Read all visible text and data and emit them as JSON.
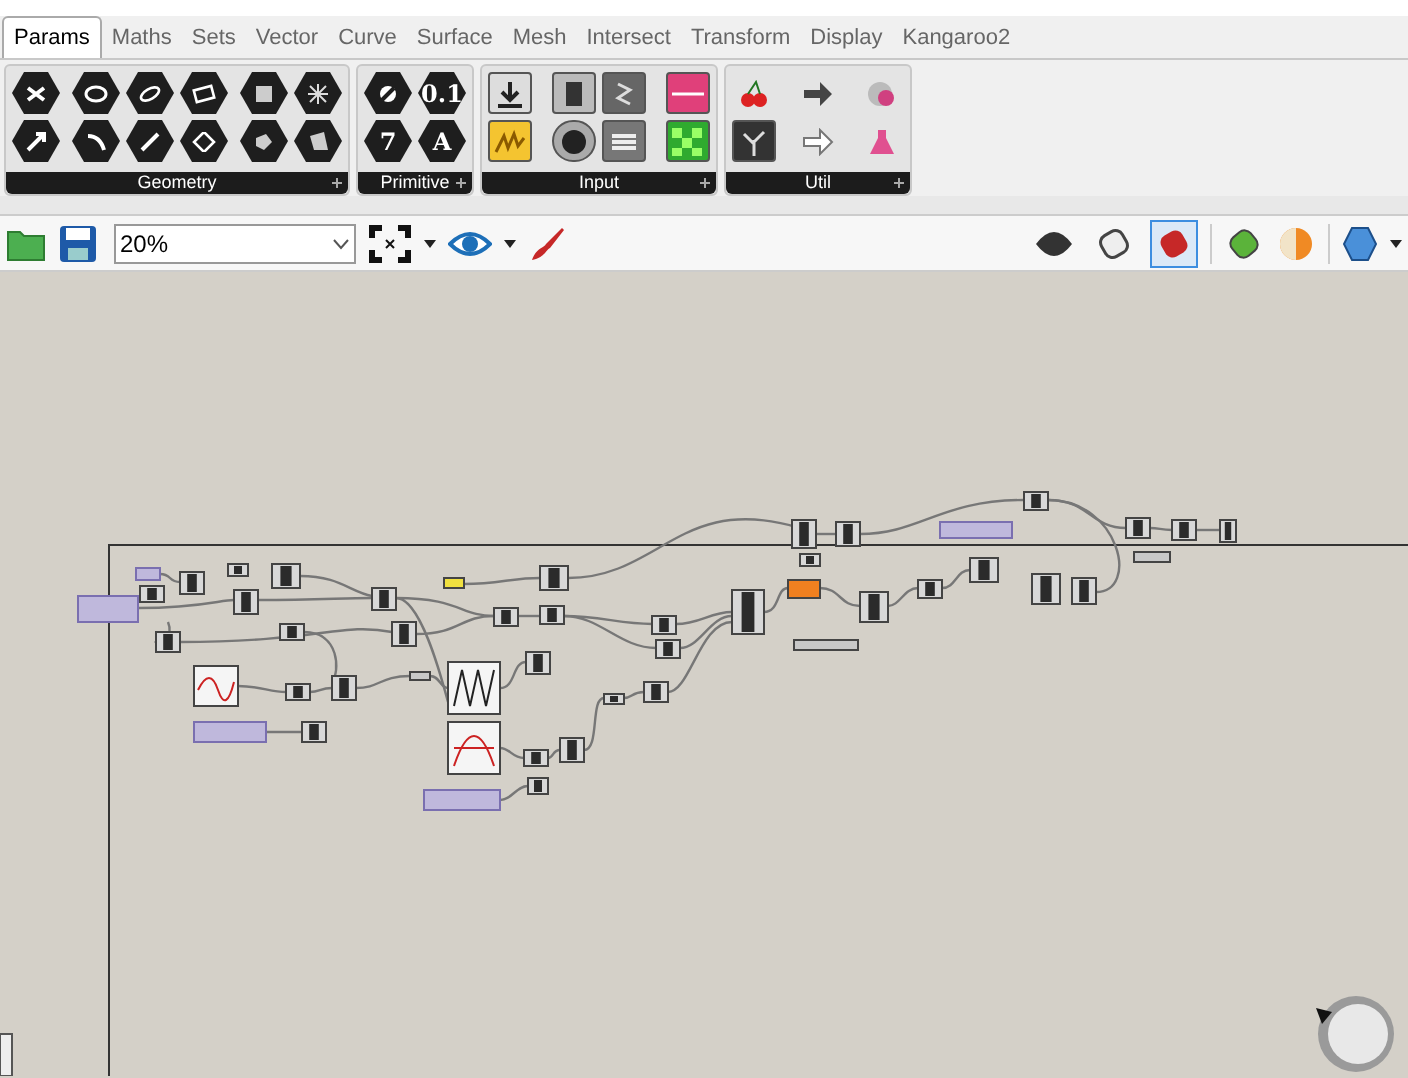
{
  "tabs": [
    {
      "label": "Params",
      "selected": true
    },
    {
      "label": "Maths",
      "selected": false
    },
    {
      "label": "Sets",
      "selected": false
    },
    {
      "label": "Vector",
      "selected": false
    },
    {
      "label": "Curve",
      "selected": false
    },
    {
      "label": "Surface",
      "selected": false
    },
    {
      "label": "Mesh",
      "selected": false
    },
    {
      "label": "Intersect",
      "selected": false
    },
    {
      "label": "Transform",
      "selected": false
    },
    {
      "label": "Display",
      "selected": false
    },
    {
      "label": "Kangaroo2",
      "selected": false
    }
  ],
  "ribbon_groups": [
    {
      "kind": "geometry",
      "label": "Geometry"
    },
    {
      "kind": "primitive",
      "label": "Primitive",
      "glyphs": [
        "0.1",
        "7",
        "A"
      ]
    },
    {
      "kind": "input",
      "label": "Input"
    },
    {
      "kind": "util",
      "label": "Util"
    }
  ],
  "toolbar": {
    "zoom": "20%",
    "preview_modes": [
      {
        "selected": false
      },
      {
        "selected": false
      },
      {
        "selected": true
      }
    ]
  }
}
